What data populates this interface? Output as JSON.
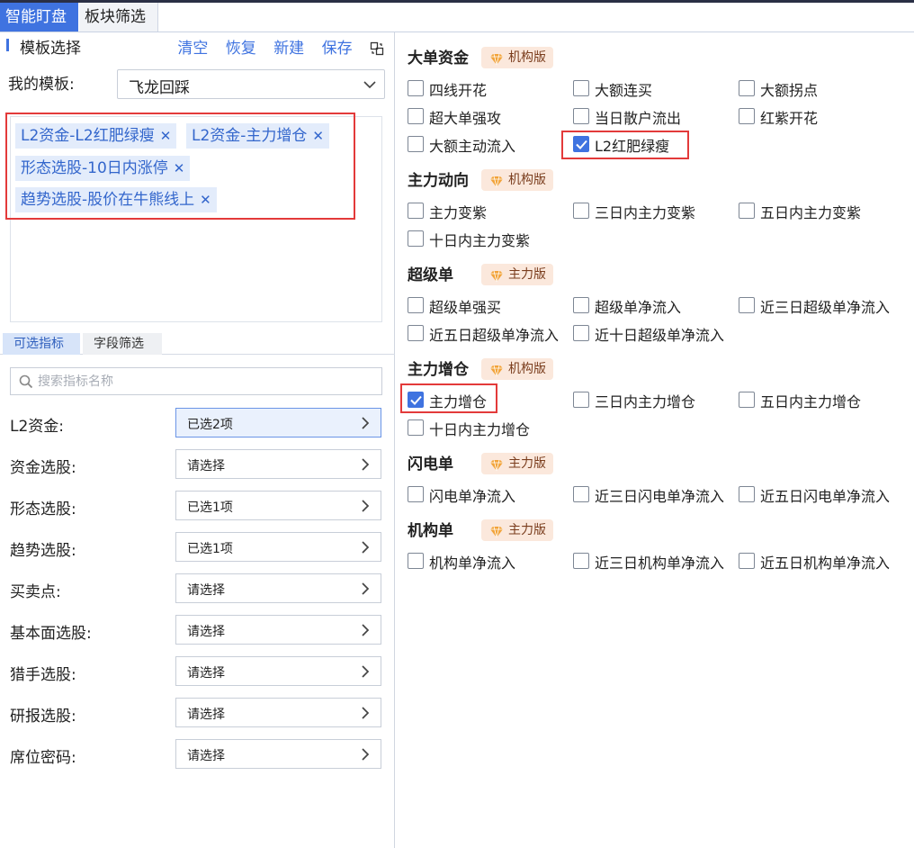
{
  "top_tabs": [
    "智能盯盘",
    "板块筛选"
  ],
  "template": {
    "title": "模板选择",
    "actions": [
      "清空",
      "恢复",
      "新建",
      "保存"
    ],
    "my_label": "我的模板:",
    "my_value": "飞龙回踩",
    "chips": [
      "L2资金-L2红肥绿瘦",
      "L2资金-主力增仓",
      "形态选股-10日内涨停",
      "趋势选股-股价在牛熊线上"
    ]
  },
  "sub_tabs": [
    "可选指标",
    "字段筛选"
  ],
  "search_placeholder": "搜索指标名称",
  "filters": [
    {
      "label": "L2资金:",
      "value": "已选2项",
      "selected": true
    },
    {
      "label": "资金选股:",
      "value": "请选择",
      "selected": false
    },
    {
      "label": "形态选股:",
      "value": "已选1项",
      "selected": false
    },
    {
      "label": "趋势选股:",
      "value": "已选1项",
      "selected": false
    },
    {
      "label": "买卖点:",
      "value": "请选择",
      "selected": false
    },
    {
      "label": "基本面选股:",
      "value": "请选择",
      "selected": false
    },
    {
      "label": "猎手选股:",
      "value": "请选择",
      "selected": false
    },
    {
      "label": "研报选股:",
      "value": "请选择",
      "selected": false
    },
    {
      "label": "席位密码:",
      "value": "请选择",
      "selected": false
    }
  ],
  "sections": [
    {
      "title": "大单资金",
      "badge": "机构版",
      "items": [
        {
          "label": "四线开花",
          "checked": false
        },
        {
          "label": "大额连买",
          "checked": false
        },
        {
          "label": "大额拐点",
          "checked": false
        },
        {
          "label": "超大单强攻",
          "checked": false
        },
        {
          "label": "当日散户流出",
          "checked": false
        },
        {
          "label": "红紫开花",
          "checked": false
        },
        {
          "label": "大额主动流入",
          "checked": false
        },
        {
          "label": "L2红肥绿瘦",
          "checked": true
        }
      ]
    },
    {
      "title": "主力动向",
      "badge": "机构版",
      "items": [
        {
          "label": "主力变紫",
          "checked": false
        },
        {
          "label": "三日内主力变紫",
          "checked": false
        },
        {
          "label": "五日内主力变紫",
          "checked": false
        },
        {
          "label": "十日内主力变紫",
          "checked": false
        }
      ]
    },
    {
      "title": "超级单",
      "badge": "主力版",
      "items": [
        {
          "label": "超级单强买",
          "checked": false
        },
        {
          "label": "超级单净流入",
          "checked": false
        },
        {
          "label": "近三日超级单净流入",
          "checked": false
        },
        {
          "label": "近五日超级单净流入",
          "checked": false
        },
        {
          "label": "近十日超级单净流入",
          "checked": false
        }
      ]
    },
    {
      "title": "主力增仓",
      "badge": "机构版",
      "items": [
        {
          "label": "主力增仓",
          "checked": true
        },
        {
          "label": "三日内主力增仓",
          "checked": false
        },
        {
          "label": "五日内主力增仓",
          "checked": false
        },
        {
          "label": "十日内主力增仓",
          "checked": false
        }
      ]
    },
    {
      "title": "闪电单",
      "badge": "主力版",
      "items": [
        {
          "label": "闪电单净流入",
          "checked": false
        },
        {
          "label": "近三日闪电单净流入",
          "checked": false
        },
        {
          "label": "近五日闪电单净流入",
          "checked": false
        }
      ]
    },
    {
      "title": "机构单",
      "badge": "主力版",
      "items": [
        {
          "label": "机构单净流入",
          "checked": false
        },
        {
          "label": "近三日机构单净流入",
          "checked": false
        },
        {
          "label": "近五日机构单净流入",
          "checked": false
        }
      ]
    }
  ],
  "colors": {
    "accent": "#3f73e0",
    "highlight": "#e33a3a",
    "chip_bg": "#e3ecfb",
    "badge_bg": "#fbe8dc"
  }
}
